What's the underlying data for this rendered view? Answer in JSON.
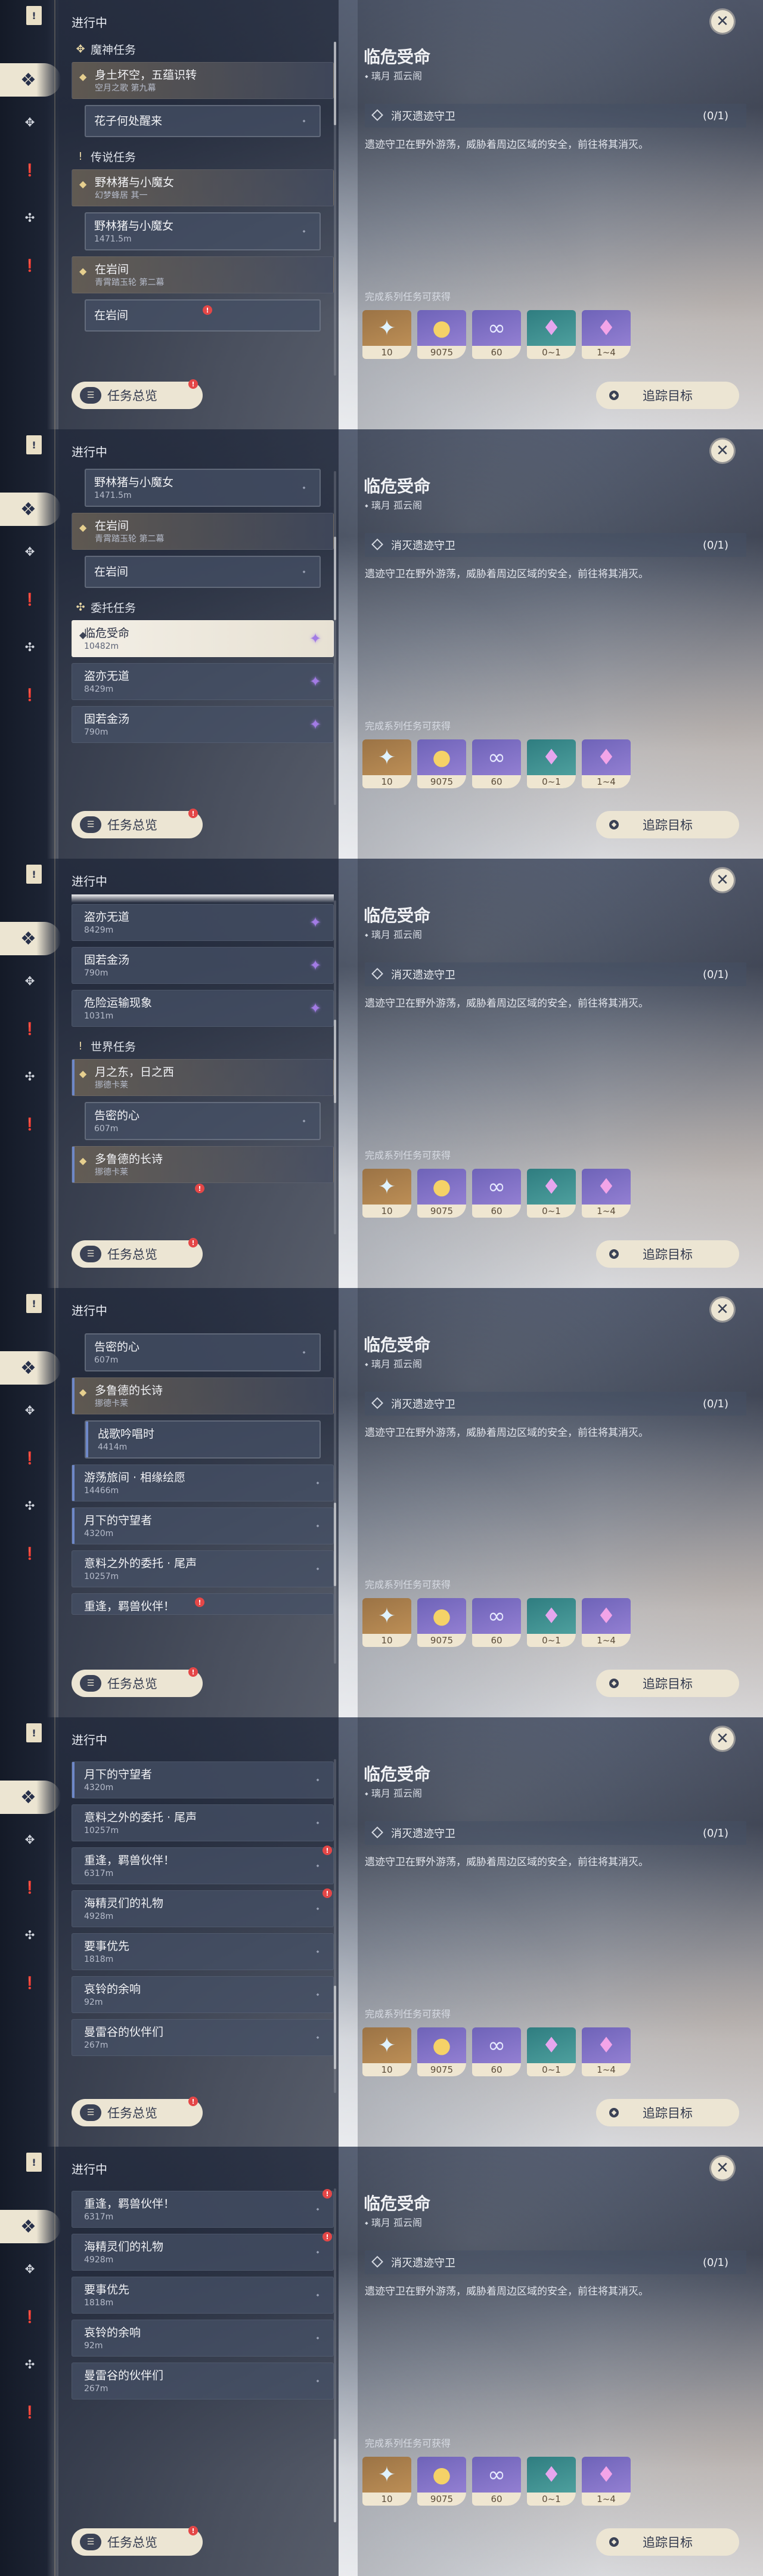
{
  "nav": {
    "book_icon": "quest-book-icon",
    "icons": [
      "all-quests-icon",
      "archon-quest-icon",
      "story-quest-icon",
      "commission-icon",
      "world-quest-icon"
    ]
  },
  "list_header": "进行中",
  "sections": {
    "archon": "魔神任务",
    "legend": "传说任务",
    "commission": "委托任务",
    "world": "世界任务"
  },
  "quests": {
    "q1": {
      "title": "身土坏空，五蕴识转",
      "sub": "空月之歌 第九幕"
    },
    "q2": {
      "title": "花子何处醒来"
    },
    "q3": {
      "title": "野林猪与小魔女",
      "sub": "幻梦蜂居 其一"
    },
    "q4": {
      "title": "野林猪与小魔女",
      "sub": "1471.5m"
    },
    "q5": {
      "title": "在岩间",
      "sub": "青霄踏玉轮 第二幕"
    },
    "q6": {
      "title": "在岩间"
    },
    "c1": {
      "title": "临危受命",
      "sub": "10482m"
    },
    "c2": {
      "title": "盗亦无道",
      "sub": "8429m"
    },
    "c3": {
      "title": "固若金汤",
      "sub": "790m"
    },
    "c4": {
      "title": "危险运输现象",
      "sub": "1031m"
    },
    "w1": {
      "title": "月之东，日之西",
      "sub": "挪德卡莱"
    },
    "w2": {
      "title": "告密的心",
      "sub": "607m"
    },
    "w3": {
      "title": "多鲁德的长诗",
      "sub": "挪德卡莱"
    },
    "w4": {
      "title": "战歌吟唱时",
      "sub": "4414m"
    },
    "w5": {
      "title": "游荡旅间 · 相缘绘愿",
      "sub": "14466m"
    },
    "w6": {
      "title": "月下的守望者",
      "sub": "4320m"
    },
    "w7": {
      "title": "意料之外的委托 · 尾声",
      "sub": "10257m"
    },
    "w8": {
      "title": "重逢，羁兽伙伴！",
      "sub": "6317m"
    },
    "w9": {
      "title": "海精灵们的礼物",
      "sub": "4928m"
    },
    "w10": {
      "title": "要事优先",
      "sub": "1818m"
    },
    "w11": {
      "title": "哀铃的余响",
      "sub": "92m"
    },
    "w12": {
      "title": "曼雷谷的伙伴们",
      "sub": "267m"
    }
  },
  "overview_label": "任务总览",
  "badge_text": "!",
  "detail": {
    "title": "临危受命",
    "location": "璃月 孤云阁",
    "objective": "消灭遗迹守卫",
    "objective_count": "(0/1)",
    "description": "遗迹守卫在野外游荡，威胁着周边区域的安全，前往将其消灭。",
    "rewards_label": "完成系列任务可获得",
    "rewards": [
      {
        "icon": "primogem-icon",
        "value": "10"
      },
      {
        "icon": "mora-icon",
        "value": "9075"
      },
      {
        "icon": "adventure-exp-icon",
        "value": "60"
      },
      {
        "icon": "enhancement-ore-icon",
        "value": "0~1"
      },
      {
        "icon": "crystal-icon",
        "value": "1~4"
      }
    ]
  },
  "track_label": "追踪目标",
  "close_icon": "close-icon"
}
